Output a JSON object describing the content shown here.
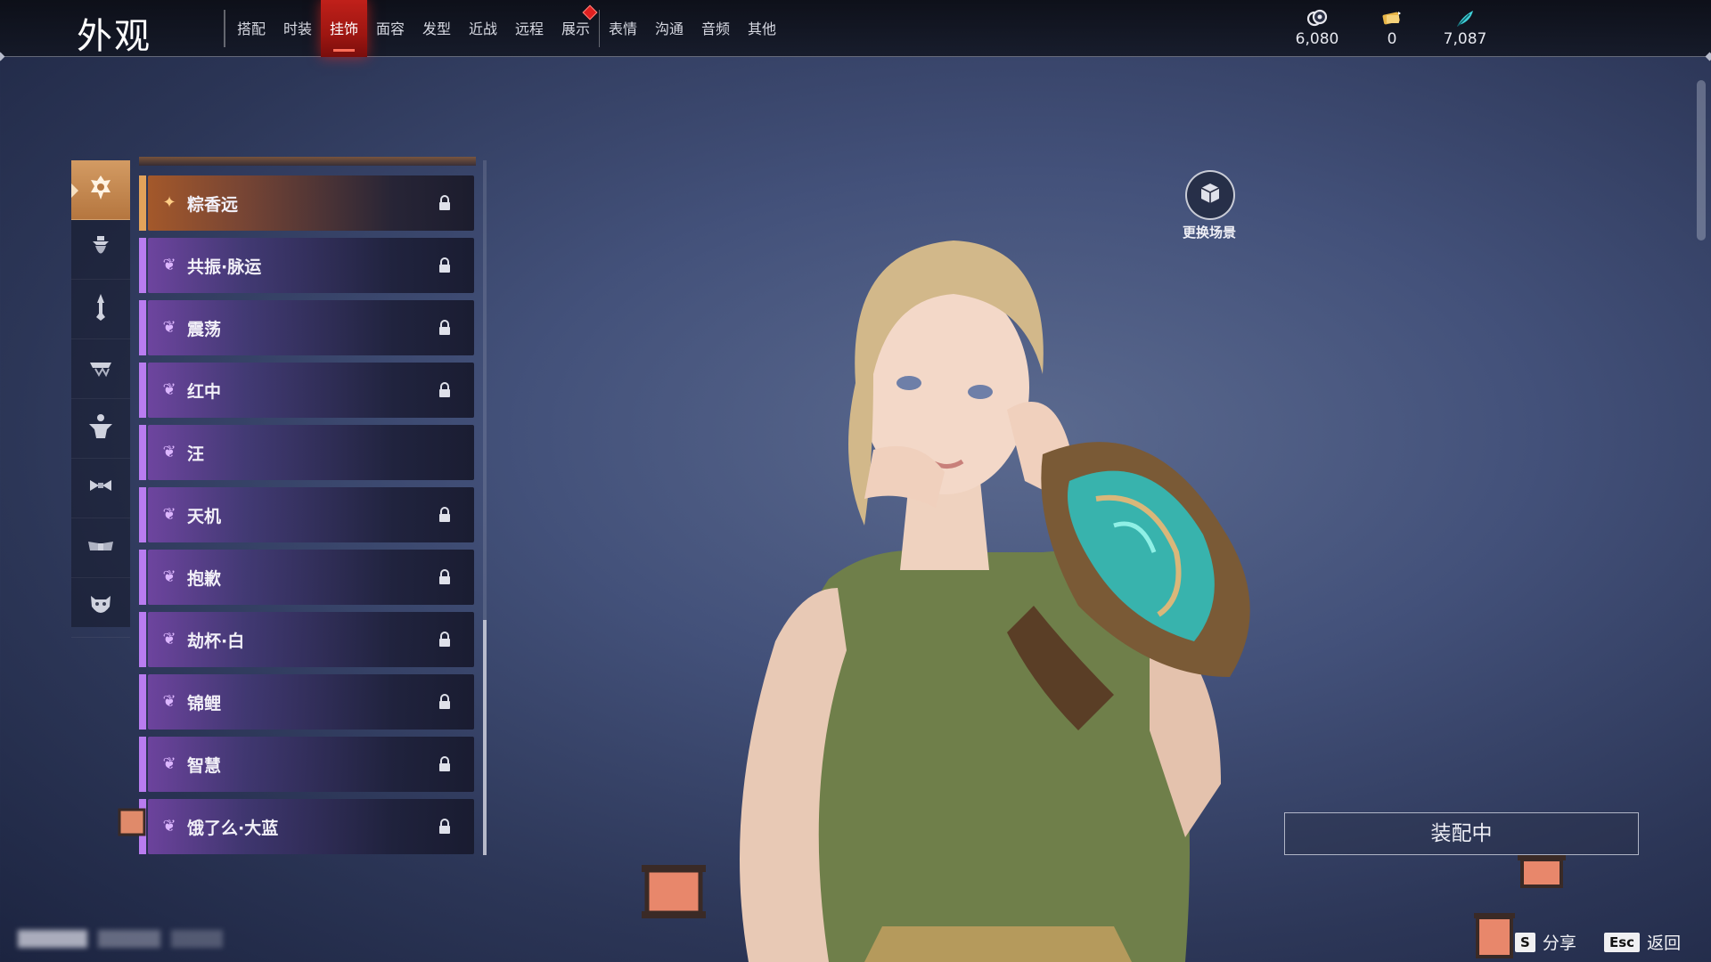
{
  "header": {
    "title": "外观",
    "tabs": [
      {
        "label": "搭配",
        "active": false
      },
      {
        "label": "时装",
        "active": false
      },
      {
        "label": "挂饰",
        "active": true
      },
      {
        "label": "面容",
        "active": false
      },
      {
        "label": "发型",
        "active": false
      },
      {
        "label": "近战",
        "active": false
      },
      {
        "label": "远程",
        "active": false
      },
      {
        "label": "展示",
        "active": false,
        "notification": true
      },
      {
        "label": "表情",
        "active": false
      },
      {
        "label": "沟通",
        "active": false
      },
      {
        "label": "音频",
        "active": false
      },
      {
        "label": "其他",
        "active": false
      }
    ],
    "currencies": [
      {
        "icon": "coin-currency-icon",
        "value": "6,080"
      },
      {
        "icon": "ticket-currency-icon",
        "value": "0"
      },
      {
        "icon": "feather-currency-icon",
        "value": "7,087"
      }
    ]
  },
  "sidebar": {
    "categories": [
      {
        "icon": "head-ornament-icon",
        "active": true
      },
      {
        "icon": "face-ornament-icon",
        "active": false
      },
      {
        "icon": "hand-ornament-icon",
        "active": false
      },
      {
        "icon": "waist-ornament-icon",
        "active": false
      },
      {
        "icon": "back-ornament-icon",
        "active": false
      },
      {
        "icon": "bow-ornament-icon",
        "active": false
      },
      {
        "icon": "wing-ornament-icon",
        "active": false
      },
      {
        "icon": "mask-ornament-icon",
        "active": false
      }
    ]
  },
  "items": [
    {
      "name": "粽香远",
      "rarity": "gold",
      "locked": true
    },
    {
      "name": "共振·脉运",
      "rarity": "purple",
      "locked": true
    },
    {
      "name": "震荡",
      "rarity": "purple",
      "locked": true
    },
    {
      "name": "红中",
      "rarity": "purple",
      "locked": true
    },
    {
      "name": "汪",
      "rarity": "purple",
      "locked": false
    },
    {
      "name": "天机",
      "rarity": "purple",
      "locked": true
    },
    {
      "name": "抱歉",
      "rarity": "purple",
      "locked": true
    },
    {
      "name": "劫杯·白",
      "rarity": "purple",
      "locked": true
    },
    {
      "name": "锦鲤",
      "rarity": "purple",
      "locked": true
    },
    {
      "name": "智慧",
      "rarity": "purple",
      "locked": true
    },
    {
      "name": "饿了么·大蓝",
      "rarity": "purple",
      "locked": true
    }
  ],
  "scene": {
    "label": "更换场景",
    "icon": "cube-scene-icon"
  },
  "equip": {
    "label": "装配中"
  },
  "hints": [
    {
      "key": "S",
      "label": "分享"
    },
    {
      "key": "Esc",
      "label": "返回"
    }
  ],
  "colors": {
    "accent_red": "#b51c16",
    "gold_rarity": "#e2a25a",
    "purple_rarity": "#b97cf0"
  }
}
